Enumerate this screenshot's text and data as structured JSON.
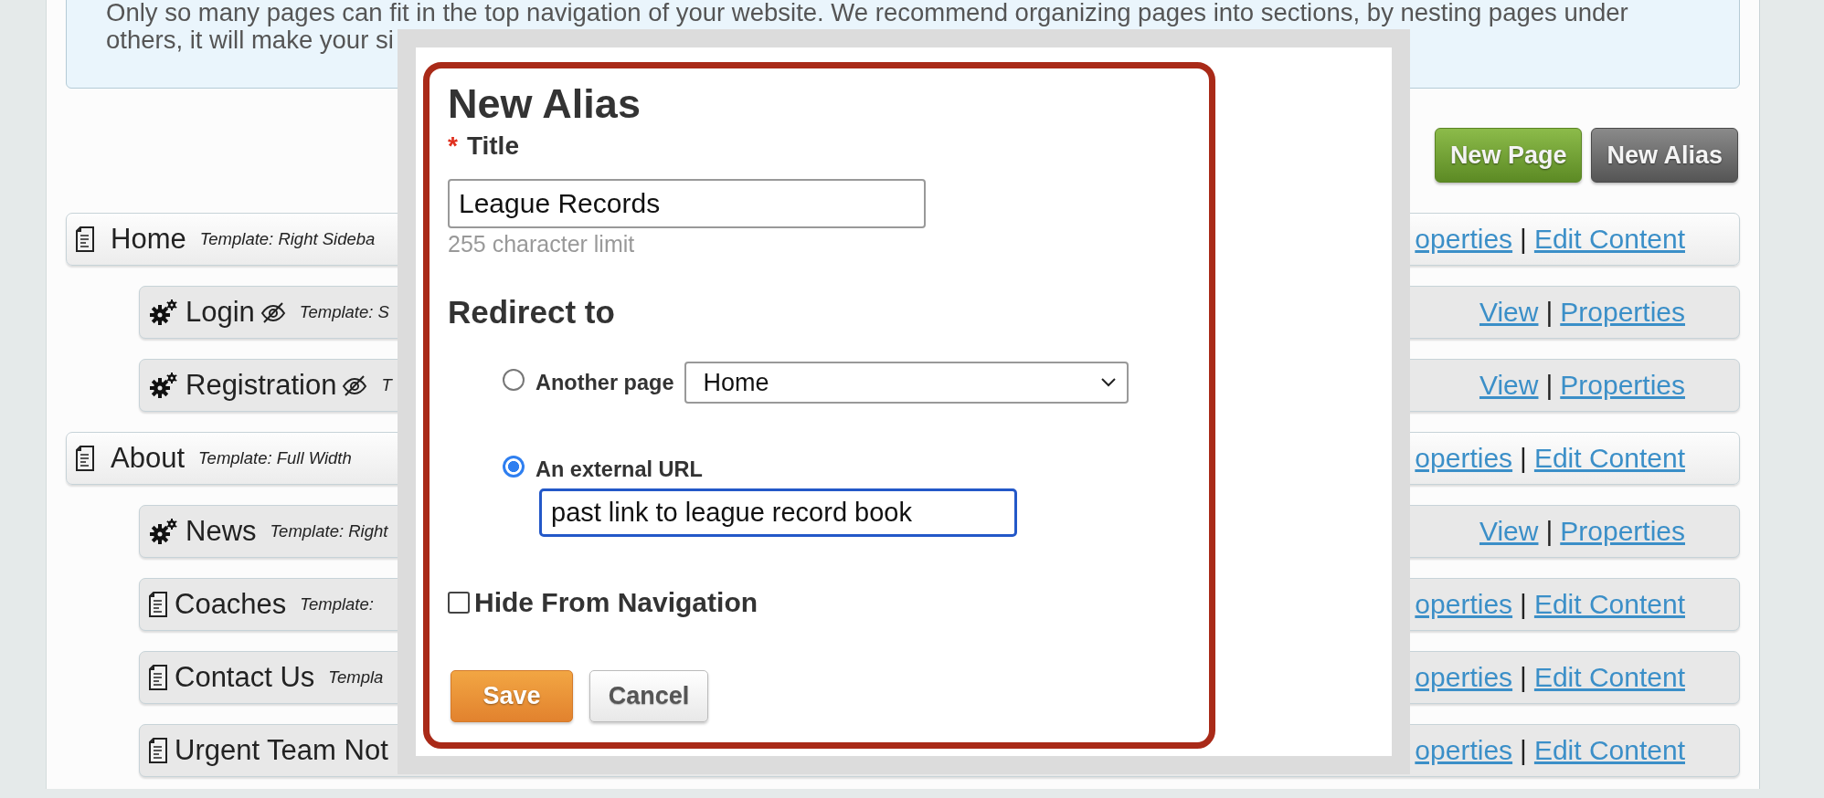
{
  "notice": {
    "lines": [
      "Only so many pages can fit in the top navigation of your website. We recommend organizing pages into sections, by nesting pages under",
      "others, it will make your si"
    ]
  },
  "toolbar": {
    "buttons": [
      {
        "label": "New Page",
        "kind": "primary"
      },
      {
        "label": "New Alias",
        "kind": "secondary"
      }
    ]
  },
  "pages": [
    {
      "name": "Home",
      "kind": "page",
      "hidden": false,
      "template": "Template: Right Sideba",
      "separator": "|",
      "links": [
        "operties",
        "Edit Content"
      ],
      "children": [
        {
          "name": "Login",
          "kind": "module",
          "hidden": true,
          "template": "Template: S",
          "separator": "|",
          "links": [
            "View",
            "Properties"
          ]
        },
        {
          "name": "Registration",
          "kind": "module",
          "hidden": true,
          "template": "T",
          "separator": "|",
          "links": [
            "View",
            "Properties"
          ]
        }
      ]
    },
    {
      "name": "About",
      "kind": "page",
      "hidden": false,
      "template": "Template: Full Width",
      "separator": "|",
      "links": [
        "operties",
        "Edit Content"
      ],
      "children": [
        {
          "name": "News",
          "kind": "module",
          "hidden": false,
          "template": "Template: Right",
          "separator": "|",
          "links": [
            "View",
            "Properties"
          ]
        },
        {
          "name": "Coaches",
          "kind": "page",
          "hidden": false,
          "template": "Template:",
          "separator": "|",
          "links": [
            "operties",
            "Edit Content"
          ]
        },
        {
          "name": "Contact Us",
          "kind": "page",
          "hidden": false,
          "template": "Templa",
          "separator": "|",
          "links": [
            "operties",
            "Edit Content"
          ]
        },
        {
          "name": "Urgent Team Not",
          "kind": "page",
          "hidden": false,
          "separator": "|",
          "links": [
            "operties",
            "Edit Content"
          ]
        }
      ]
    }
  ],
  "dialog": {
    "heading": "New Alias",
    "title_field": {
      "required_mark": "*",
      "label": "Title",
      "value": "League Records",
      "hint": "255 character limit"
    },
    "redirect": {
      "heading": "Redirect to",
      "options": [
        {
          "label": "Another page",
          "kind": "select",
          "selected": false,
          "focused": false,
          "value": "Home"
        },
        {
          "label": "An external URL",
          "kind": "text",
          "selected": true,
          "focused": true,
          "value": "past link to league record book"
        }
      ]
    },
    "hide_from_navigation": {
      "label": "Hide From Navigation",
      "checked": false
    },
    "buttons": [
      {
        "label": "Save",
        "kind": "primary"
      },
      {
        "label": "Cancel",
        "kind": "secondary"
      }
    ]
  }
}
